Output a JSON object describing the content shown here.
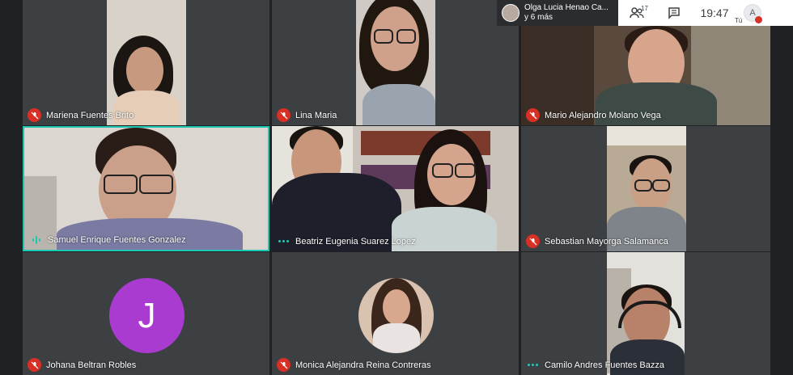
{
  "notification": {
    "line1": "Olga Lucia Henao Ca...",
    "line2": "y 6 más"
  },
  "controls": {
    "participants_count": "17",
    "clock": "19:47",
    "self_initial": "A",
    "self_label": "Tú"
  },
  "participants": [
    {
      "name": "Mariena Fuentes Brito",
      "status": "muted"
    },
    {
      "name": "Lina Maria",
      "status": "muted"
    },
    {
      "name": "Mario Alejandro Molano Vega",
      "status": "muted"
    },
    {
      "name": "Samuel Enrique Fuentes Gonzalez",
      "status": "speaking"
    },
    {
      "name": "Beatriz Eugenia Suarez Lopez",
      "status": "more"
    },
    {
      "name": "Sebastian Mayorga Salamanca",
      "status": "muted"
    },
    {
      "name": "Johana Beltran Robles",
      "status": "muted",
      "initial": "J",
      "avatar_color": "#a93bd1"
    },
    {
      "name": "Monica Alejandra Reina Contreras",
      "status": "muted"
    },
    {
      "name": "Camilo Andres Fuentes Bazza",
      "status": "more"
    }
  ],
  "colors": {
    "background": "#202124",
    "tile": "#3c4043",
    "muted": "#d93025",
    "speaking": "#1dc8b3"
  }
}
